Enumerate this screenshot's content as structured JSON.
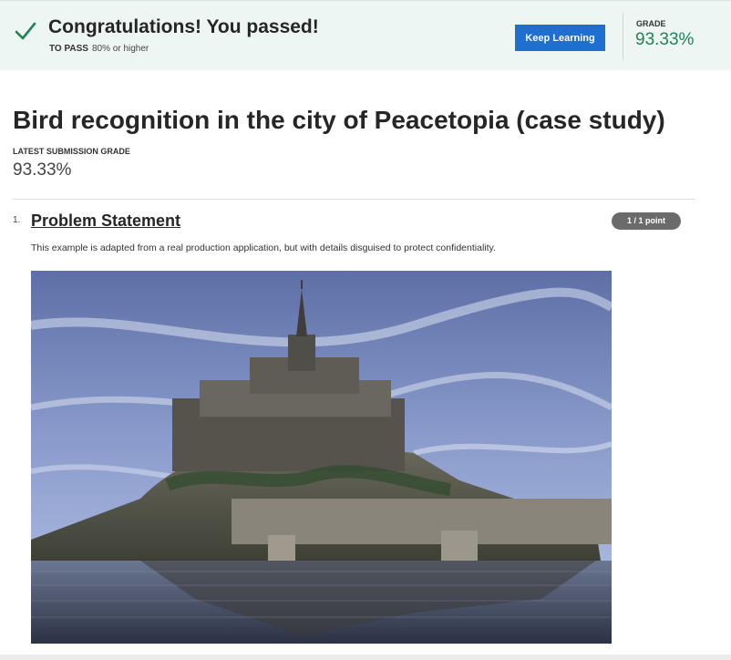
{
  "banner": {
    "title": "Congratulations! You passed!",
    "to_pass_label": "TO PASS",
    "to_pass_value": "80% or higher",
    "keep_learning_label": "Keep Learning",
    "grade_label": "GRADE",
    "grade_value": "93.33%",
    "check_icon": "checkmark-icon",
    "accent_color": "#1f8354",
    "button_color": "#1f6fd1"
  },
  "page": {
    "title": "Bird recognition in the city of Peacetopia (case study)",
    "latest_label": "LATEST SUBMISSION GRADE",
    "latest_value": "93.33%"
  },
  "question": {
    "number": "1.",
    "title": "Problem Statement",
    "points": "1 / 1 point",
    "description": "This example is adapted from a real production application, but with details disguised to protect confidentiality.",
    "image_alt": "Castle on a tidal island with reflection in water"
  }
}
